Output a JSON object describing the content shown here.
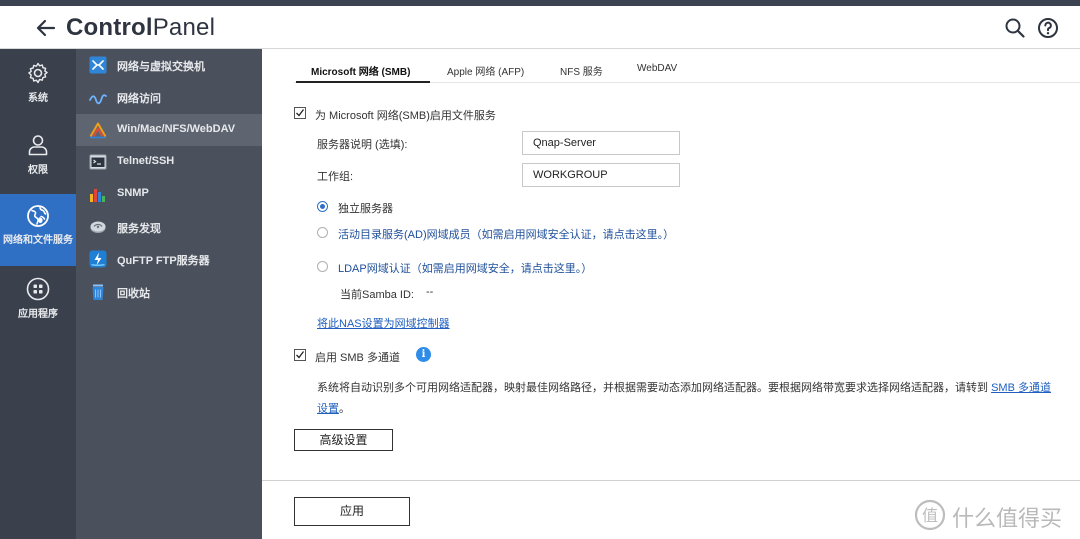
{
  "app": {
    "title_bold": "Control",
    "title_rest": "Panel"
  },
  "rail": [
    {
      "label": "系统",
      "icon": "gear-icon"
    },
    {
      "label": "权限",
      "icon": "user-icon"
    },
    {
      "label": "网络和文件服务",
      "icon": "globe-icon",
      "active": true
    },
    {
      "label": "应用程序",
      "icon": "apps-grid-icon"
    }
  ],
  "subnav": [
    {
      "label": "网络与虚拟交换机",
      "icon": "network-switch-icon"
    },
    {
      "label": "网络访问",
      "icon": "network-access-icon"
    },
    {
      "label": "Win/Mac/NFS/WebDAV",
      "icon": "file-services-icon",
      "active": true
    },
    {
      "label": "Telnet/SSH",
      "icon": "terminal-icon"
    },
    {
      "label": "SNMP",
      "icon": "snmp-icon"
    },
    {
      "label": "服务发现",
      "icon": "service-discovery-icon"
    },
    {
      "label": "QuFTP FTP服务器",
      "icon": "ftp-icon"
    },
    {
      "label": "回收站",
      "icon": "recycle-bin-icon"
    }
  ],
  "tabs": [
    {
      "label": "Microsoft 网络 (SMB)",
      "active": true
    },
    {
      "label": "Apple 网络 (AFP)"
    },
    {
      "label": "NFS 服务"
    },
    {
      "label": "WebDAV"
    }
  ],
  "smb": {
    "enable_label": "为 Microsoft 网络(SMB)启用文件服务",
    "enable_checked": true,
    "server_desc_label": "服务器说明 (选填):",
    "server_desc_value": "Qnap-Server",
    "workgroup_label": "工作组:",
    "workgroup_value": "WORKGROUP",
    "radio_standalone": "独立服务器",
    "radio_ad": "活动目录服务(AD)网域成员（如需启用网域安全认证，请点击这里。）",
    "radio_ldap": "LDAP网域认证（如需启用网域安全，请点击这里。）",
    "samba_id_label": "当前Samba ID:",
    "samba_id_value": "--",
    "domain_controller_link": "将此NAS设置为网域控制器",
    "multichannel_label": "启用 SMB 多通道",
    "multichannel_checked": true,
    "info_glyph": "i",
    "desc_text": "系统将自动识别多个可用网络适配器，映射最佳网络路径，并根据需要动态添加网络适配器。要根据网络带宽要求选择网络适配器，请转到 ",
    "desc_link": "SMB 多通道设置",
    "desc_end": "。",
    "advanced_button": "高级设置",
    "apply_button": "应用"
  },
  "watermark": "什么值得买",
  "colors": {
    "accent": "#2f6fc4",
    "rail_bg": "#3a414c",
    "subnav_bg": "#4a515c",
    "link": "#1e5fbf"
  }
}
